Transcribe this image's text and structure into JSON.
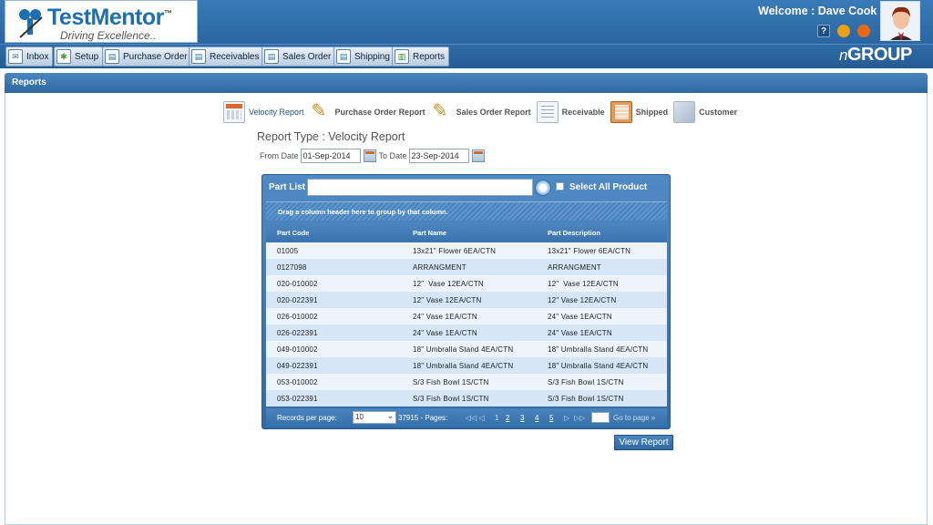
{
  "header": {
    "logo_title": "TestMentor",
    "logo_tm": "™",
    "logo_tagline": "Driving Excellence..",
    "welcome": "Welcome : Dave Cook",
    "help_label": "?",
    "brand": "nGROUP"
  },
  "nav": {
    "items": [
      {
        "label": "Inbox",
        "icon": "mail-icon"
      },
      {
        "label": "Setup",
        "icon": "gear-icon"
      },
      {
        "label": "Purchase Order",
        "icon": "document-icon"
      },
      {
        "label": "Receivables",
        "icon": "document-icon"
      },
      {
        "label": "Sales Order",
        "icon": "document-icon"
      },
      {
        "label": "Shipping",
        "icon": "document-icon"
      },
      {
        "label": "Reports",
        "icon": "chart-icon"
      }
    ]
  },
  "section": {
    "title": "Reports"
  },
  "report_tabs": [
    {
      "label": "Velocity Report",
      "icon": "calendar-icon",
      "active": true
    },
    {
      "label": "Purchase Order Report",
      "icon": "pencil-icon"
    },
    {
      "label": "Sales Order Report",
      "icon": "pencil-icon"
    },
    {
      "label": "Receivable",
      "icon": "document-icon"
    },
    {
      "label": "Shipped",
      "icon": "book-icon"
    },
    {
      "label": "Customer",
      "icon": "box-icon"
    }
  ],
  "report_type": "Report Type : Velocity Report",
  "dates": {
    "from_label": "From Date",
    "from_value": "01-Sep-2014",
    "to_label": "To Date",
    "to_value": "23-Sep-2014"
  },
  "part_list": {
    "label": "Part List",
    "search_value": "",
    "select_all_label": "Select All Product",
    "group_hint": "Drag a column header here to group by that column.",
    "columns": [
      "Part Code",
      "Part Name",
      "Part Description"
    ],
    "rows": [
      [
        "01005",
        "13x21\" Flower 6EA/CTN",
        "13x21\" Flower 6EA/CTN"
      ],
      [
        "0127098",
        "ARRANGMENT",
        "ARRANGMENT"
      ],
      [
        "020-010002",
        "12\"  Vase 12EA/CTN",
        "12\"  Vase 12EA/CTN"
      ],
      [
        "020-022391",
        "12\" Vase 12EA/CTN",
        "12\" Vase 12EA/CTN"
      ],
      [
        "026-010002",
        "24\" Vase 1EA/CTN",
        "24\" Vase 1EA/CTN"
      ],
      [
        "026-022391",
        "24\" Vase 1EA/CTN",
        "24\" Vase 1EA/CTN"
      ],
      [
        "049-010002",
        "18\" Umbralla Stand 4EA/CTN",
        "18\" Umbralla Stand 4EA/CTN"
      ],
      [
        "049-022391",
        "18\" Umbralla Stand 4EA/CTN",
        "18\" Umbralla Stand 4EA/CTN"
      ],
      [
        "053-010002",
        "S/3 Fish Bowl 1S/CTN",
        "S/3 Fish Bowl 1S/CTN"
      ],
      [
        "053-022391",
        "S/3 Fish Bowl 1S/CTN",
        "S/3 Fish Bowl 1S/CTN"
      ]
    ],
    "pager": {
      "records_label": "Records per page:",
      "page_size": "10",
      "total_text": "37915 - Pages:",
      "nav_first": "◁◁",
      "nav_prev": "◁",
      "pages": [
        "1",
        "2",
        "3",
        "4",
        "5"
      ],
      "nav_next": "▷",
      "nav_last": "▷▷",
      "goto_label": "Go to page »"
    }
  },
  "view_report_label": "View Report"
}
